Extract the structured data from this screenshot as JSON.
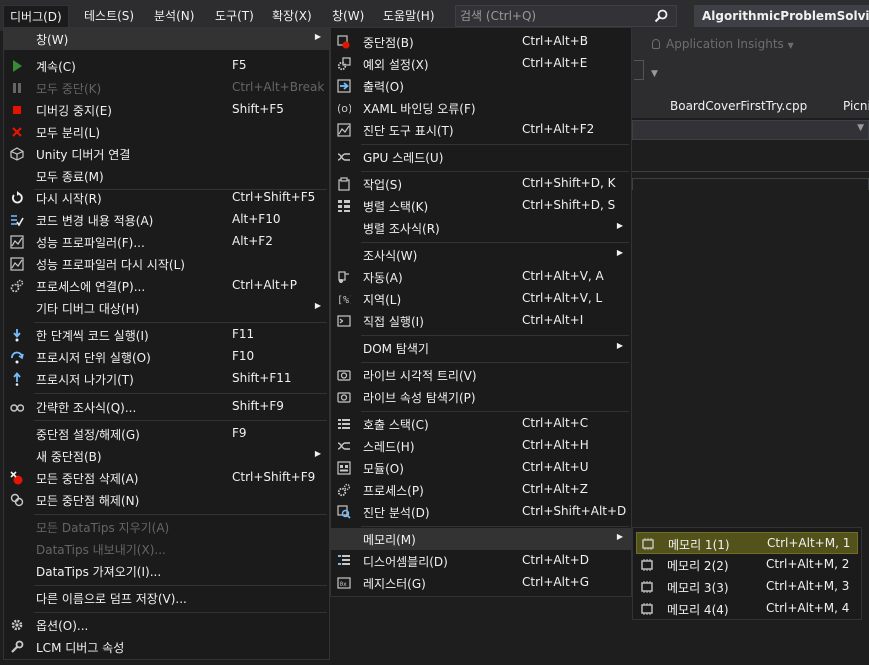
{
  "menubar": {
    "items": [
      "디버그(D)",
      "테스트(S)",
      "분석(N)",
      "도구(T)",
      "확장(X)",
      "창(W)",
      "도움말(H)"
    ],
    "search_placeholder": "검색 (Ctrl+Q)",
    "solution_title": "AlgorithmicProblemSolvingSt"
  },
  "background": {
    "insights_label": "Application Insights",
    "tabs": [
      "BoardCoverFirstTry.cpp",
      "Picni"
    ]
  },
  "debug_menu": {
    "items": [
      {
        "label": "창(W)",
        "shortcut": "",
        "icon": "",
        "submenu": true,
        "highlight": true
      },
      {
        "label": "계속(C)",
        "shortcut": "F5",
        "icon": "continue-icon"
      },
      {
        "label": "모두 중단(K)",
        "shortcut": "Ctrl+Alt+Break",
        "icon": "break-all-icon",
        "disabled": true
      },
      {
        "label": "디버깅 중지(E)",
        "shortcut": "Shift+F5",
        "icon": "stop-icon"
      },
      {
        "label": "모두 분리(L)",
        "shortcut": "",
        "icon": "detach-icon"
      },
      {
        "label": "Unity 디버거 연결",
        "shortcut": "",
        "icon": "unity-icon"
      },
      {
        "label": "모두 종료(M)",
        "shortcut": "",
        "icon": ""
      },
      {
        "label": "다시 시작(R)",
        "shortcut": "Ctrl+Shift+F5",
        "icon": "restart-icon"
      },
      {
        "label": "코드 변경 내용 적용(A)",
        "shortcut": "Alt+F10",
        "icon": "apply-changes-icon"
      },
      {
        "label": "성능 프로파일러(F)...",
        "shortcut": "Alt+F2",
        "icon": "profiler-icon"
      },
      {
        "label": "성능 프로파일러 다시 시작(L)",
        "shortcut": "",
        "icon": "profiler-restart-icon"
      },
      {
        "label": "프로세스에 연결(P)...",
        "shortcut": "Ctrl+Alt+P",
        "icon": "attach-process-icon"
      },
      {
        "label": "기타 디버그 대상(H)",
        "shortcut": "",
        "icon": "",
        "submenu": true
      },
      {
        "label": "한 단계씩 코드 실행(I)",
        "shortcut": "F11",
        "icon": "step-into-icon"
      },
      {
        "label": "프로시저 단위 실행(O)",
        "shortcut": "F10",
        "icon": "step-over-icon"
      },
      {
        "label": "프로시저 나가기(T)",
        "shortcut": "Shift+F11",
        "icon": "step-out-icon"
      },
      {
        "label": "간략한 조사식(Q)...",
        "shortcut": "Shift+F9",
        "icon": "quickwatch-icon"
      },
      {
        "label": "중단점 설정/해제(G)",
        "shortcut": "F9",
        "icon": ""
      },
      {
        "label": "새 중단점(B)",
        "shortcut": "",
        "icon": "",
        "submenu": true
      },
      {
        "label": "모든 중단점 삭제(A)",
        "shortcut": "Ctrl+Shift+F9",
        "icon": "delete-breakpoints-icon"
      },
      {
        "label": "모든 중단점 해제(N)",
        "shortcut": "",
        "icon": "disable-breakpoints-icon"
      },
      {
        "label": "모든 DataTips 지우기(A)",
        "shortcut": "",
        "icon": "",
        "disabled": true
      },
      {
        "label": "DataTips 내보내기(X)...",
        "shortcut": "",
        "icon": "",
        "disabled": true
      },
      {
        "label": "DataTips 가져오기(I)...",
        "shortcut": "",
        "icon": ""
      },
      {
        "label": "다른 이름으로 덤프 저장(V)...",
        "shortcut": "",
        "icon": ""
      },
      {
        "label": "옵션(O)...",
        "shortcut": "",
        "icon": "gear-icon"
      },
      {
        "label": "LCM 디버그 속성",
        "shortcut": "",
        "icon": "wrench-icon"
      }
    ]
  },
  "window_menu": {
    "items": [
      {
        "label": "중단점(B)",
        "shortcut": "Ctrl+Alt+B",
        "icon": "breakpoints-window-icon"
      },
      {
        "label": "예외 설정(X)",
        "shortcut": "Ctrl+Alt+E",
        "icon": "exception-settings-icon"
      },
      {
        "label": "출력(O)",
        "shortcut": "",
        "icon": "output-icon"
      },
      {
        "label": "XAML 바인딩 오류(F)",
        "shortcut": "",
        "icon": "xaml-binding-icon"
      },
      {
        "label": "진단 도구 표시(T)",
        "shortcut": "Ctrl+Alt+F2",
        "icon": "diagnostic-tools-icon"
      },
      {
        "label": "GPU 스레드(U)",
        "shortcut": "",
        "icon": "gpu-threads-icon"
      },
      {
        "label": "작업(S)",
        "shortcut": "Ctrl+Shift+D, K",
        "icon": "tasks-icon"
      },
      {
        "label": "병렬 스택(K)",
        "shortcut": "Ctrl+Shift+D, S",
        "icon": "parallel-stacks-icon"
      },
      {
        "label": "병렬 조사식(R)",
        "shortcut": "",
        "icon": "",
        "submenu": true
      },
      {
        "label": "조사식(W)",
        "shortcut": "",
        "icon": "",
        "submenu": true
      },
      {
        "label": "자동(A)",
        "shortcut": "Ctrl+Alt+V, A",
        "icon": "autos-icon"
      },
      {
        "label": "지역(L)",
        "shortcut": "Ctrl+Alt+V, L",
        "icon": "locals-icon"
      },
      {
        "label": "직접 실행(I)",
        "shortcut": "Ctrl+Alt+I",
        "icon": "immediate-icon"
      },
      {
        "label": "DOM 탐색기",
        "shortcut": "",
        "icon": "",
        "submenu": true
      },
      {
        "label": "라이브 시각적 트리(V)",
        "shortcut": "",
        "icon": "live-visual-tree-icon"
      },
      {
        "label": "라이브 속성 탐색기(P)",
        "shortcut": "",
        "icon": "live-property-icon"
      },
      {
        "label": "호출 스택(C)",
        "shortcut": "Ctrl+Alt+C",
        "icon": "call-stack-icon"
      },
      {
        "label": "스레드(H)",
        "shortcut": "Ctrl+Alt+H",
        "icon": "threads-icon"
      },
      {
        "label": "모듈(O)",
        "shortcut": "Ctrl+Alt+U",
        "icon": "modules-icon"
      },
      {
        "label": "프로세스(P)",
        "shortcut": "Ctrl+Alt+Z",
        "icon": "processes-icon"
      },
      {
        "label": "진단 분석(D)",
        "shortcut": "Ctrl+Shift+Alt+D",
        "icon": "diagnostic-analysis-icon"
      },
      {
        "label": "메모리(M)",
        "shortcut": "",
        "icon": "",
        "submenu": true,
        "highlight": true
      },
      {
        "label": "디스어셈블리(D)",
        "shortcut": "Ctrl+Alt+D",
        "icon": "disassembly-icon"
      },
      {
        "label": "레지스터(G)",
        "shortcut": "Ctrl+Alt+G",
        "icon": "registers-icon"
      }
    ]
  },
  "memory_menu": {
    "items": [
      {
        "label": "메모리 1(1)",
        "shortcut": "Ctrl+Alt+M, 1",
        "highlight": true
      },
      {
        "label": "메모리 2(2)",
        "shortcut": "Ctrl+Alt+M, 2"
      },
      {
        "label": "메모리 3(3)",
        "shortcut": "Ctrl+Alt+M, 3"
      },
      {
        "label": "메모리 4(4)",
        "shortcut": "Ctrl+Alt+M, 4"
      }
    ]
  },
  "colors": {
    "menu_bg": "#1b1b1c",
    "highlight": "#333334",
    "memory_highlight": "#52521a",
    "accent_blue": "#75beff",
    "stop_red": "#e51400",
    "continue_green": "#388a34"
  }
}
